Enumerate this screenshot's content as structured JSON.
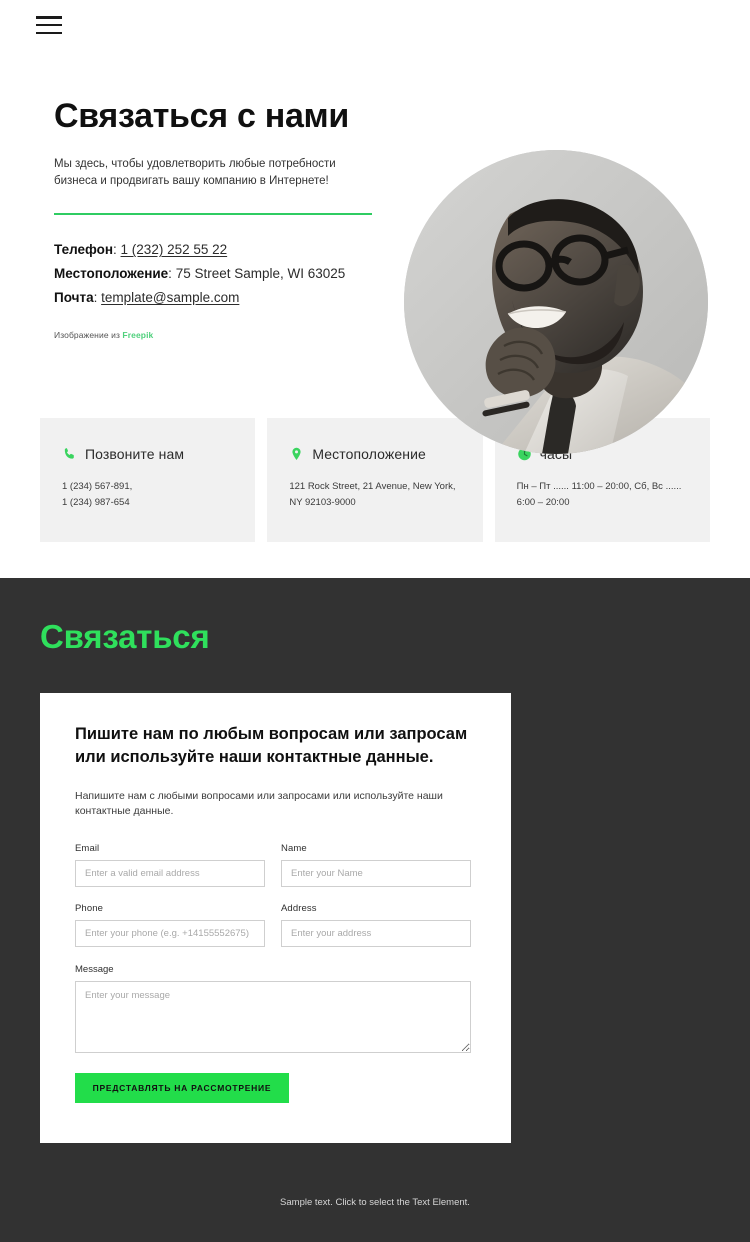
{
  "header": {
    "menu_icon": "hamburger-menu-icon"
  },
  "hero": {
    "title": "Связаться с нами",
    "subtitle": "Мы здесь, чтобы удовлетворить любые потребности бизнеса и продвигать вашу компанию в Интернете!",
    "contact": {
      "phone_label": "Телефон",
      "phone_value": "1 (232) 252 55 22",
      "location_label": "Местоположение",
      "location_value": "75 Street Sample, WI 63025",
      "email_label": "Почта",
      "email_value": "template@sample.com",
      "separator": ": "
    },
    "credit_text": "Изображение из",
    "credit_link": "Freepik",
    "photo_alt": "portrait-photo"
  },
  "cards": [
    {
      "icon": "phone-icon",
      "title": "Позвоните нам",
      "body": "1 (234) 567-891,\n1 (234) 987-654"
    },
    {
      "icon": "map-pin-icon",
      "title": "Местоположение",
      "body": "121 Rock Street, 21 Avenue, New York,\nNY 92103-9000"
    },
    {
      "icon": "clock-icon",
      "title": "часы",
      "body": "Пн – Пт ...... 11:00 – 20:00, Сб, Вс  ......\n6:00 – 20:00"
    }
  ],
  "contact_section": {
    "title": "Связаться",
    "form_title": "Пишите нам по любым вопросам или запросам\nили используйте наши контактные данные.",
    "form_intro": "Напишите нам с любыми вопросами или запросами или используйте наши контактные данные.",
    "fields": [
      {
        "label": "Email",
        "placeholder": "Enter a valid email address",
        "value": "",
        "name": "email-field"
      },
      {
        "label": "Name",
        "placeholder": "Enter your Name",
        "value": "",
        "name": "name-field"
      },
      {
        "label": "Phone",
        "placeholder": "Enter your phone (e.g. +14155552675)",
        "value": "",
        "name": "phone-field"
      },
      {
        "label": "Address",
        "placeholder": "Enter your address",
        "value": "",
        "name": "address-field"
      }
    ],
    "message": {
      "label": "Message",
      "placeholder": "Enter your message",
      "value": ""
    },
    "submit_label": "ПРЕДСТАВЛЯТЬ НА РАССМОТРЕНИЕ"
  },
  "footer": {
    "text": "Sample text. Click to select the Text Element."
  },
  "colors": {
    "accent_green": "#22dd4a",
    "heading_green": "#2fe05c",
    "rule_green": "#2fcc62",
    "icon_green": "#3ad45f",
    "dark_bg": "#323232",
    "card_bg": "#f1f1f1"
  }
}
